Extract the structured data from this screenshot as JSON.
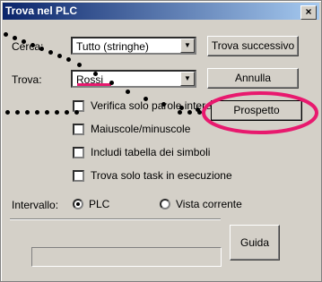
{
  "window": {
    "title": "Trova nel PLC",
    "close_glyph": "×"
  },
  "cerca": {
    "label": "Cerca:",
    "value": "Tutto (stringhe)"
  },
  "trova": {
    "label": "Trova:",
    "value": "Rossi"
  },
  "buttons": {
    "find_next": "Trova successivo",
    "cancel": "Annulla",
    "browse": "Prospetto",
    "help": "Guida"
  },
  "options": [
    {
      "label": "Verifica solo parole intere",
      "checked": false
    },
    {
      "label": "Maiuscole/minuscole",
      "checked": false
    },
    {
      "label": "Includi tabella dei simboli",
      "checked": false
    },
    {
      "label": "Trova solo task in esecuzione",
      "checked": false
    }
  ],
  "intervallo": {
    "label": "Intervallo:",
    "options": [
      {
        "label": "PLC",
        "selected": true
      },
      {
        "label": "Vista corrente",
        "selected": false
      }
    ]
  },
  "annotations": {
    "highlight_color": "#e8196e",
    "dot_color": "#000000"
  }
}
